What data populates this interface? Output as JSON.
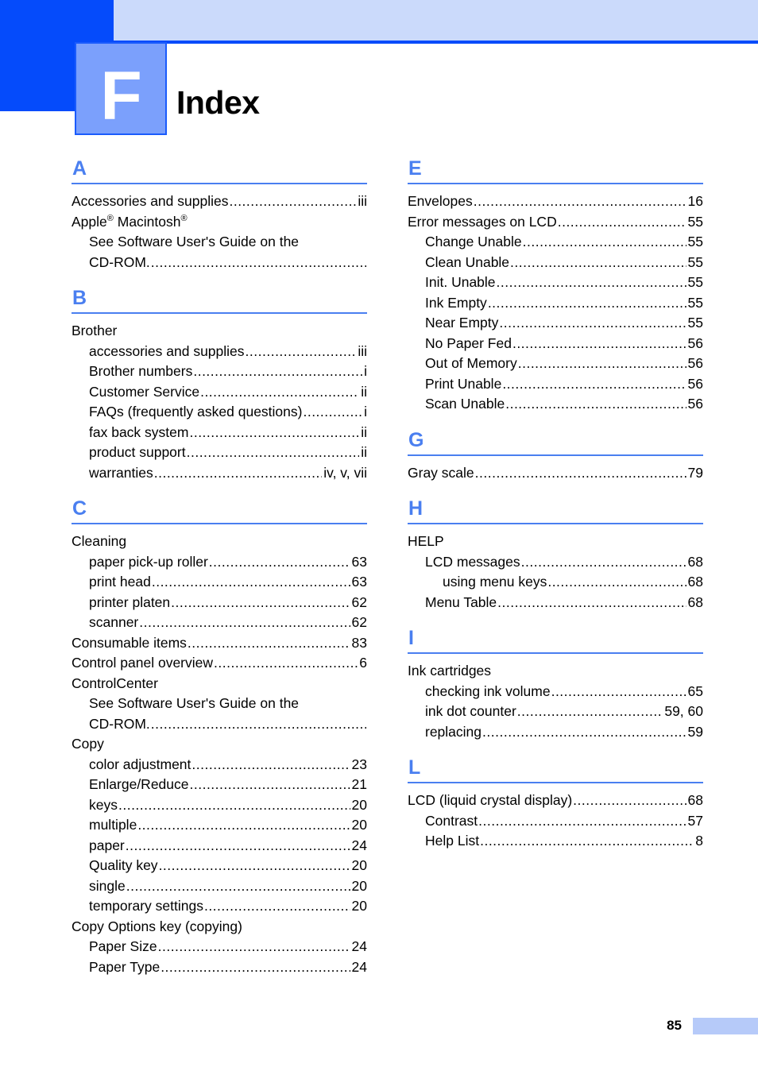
{
  "header": {
    "chapter_letter": "F",
    "title": "Index",
    "colors": {
      "dark_blue": "#054bfb",
      "banner_blue": "#cbdafb",
      "tile_blue": "#7ba0fc",
      "accent_blue": "#4a7ff0",
      "footer_bar": "#b6caf9"
    }
  },
  "footer": {
    "page_number": "85"
  },
  "columns": {
    "left": [
      {
        "letter": "A",
        "entries": [
          {
            "level": 1,
            "label": "Accessories and supplies",
            "page": "iii",
            "leader": true
          },
          {
            "level": 1,
            "label": "Apple® Macintosh®",
            "page": "",
            "leader": false,
            "html": "Apple<sup>®</sup> Macintosh<sup>®</sup>"
          },
          {
            "level": 2,
            "label": "See Software User's Guide on the",
            "page": "",
            "leader": false
          },
          {
            "level": 2,
            "label": "CD-ROM.",
            "page": "",
            "leader": true
          }
        ]
      },
      {
        "letter": "B",
        "entries": [
          {
            "level": 1,
            "label": "Brother",
            "page": "",
            "leader": false
          },
          {
            "level": 2,
            "label": "accessories and supplies",
            "page": "iii",
            "leader": true
          },
          {
            "level": 2,
            "label": "Brother numbers",
            "page": "i",
            "leader": true
          },
          {
            "level": 2,
            "label": "Customer Service",
            "page": "ii",
            "leader": true
          },
          {
            "level": 2,
            "label": "FAQs (frequently asked questions)",
            "page": "i",
            "leader": true
          },
          {
            "level": 2,
            "label": "fax back system",
            "page": "ii",
            "leader": true
          },
          {
            "level": 2,
            "label": "product support",
            "page": "ii",
            "leader": true
          },
          {
            "level": 2,
            "label": "warranties",
            "page": "iv, v, vii",
            "leader": true
          }
        ]
      },
      {
        "letter": "C",
        "entries": [
          {
            "level": 1,
            "label": "Cleaning",
            "page": "",
            "leader": false
          },
          {
            "level": 2,
            "label": "paper pick-up roller",
            "page": "63",
            "leader": true
          },
          {
            "level": 2,
            "label": "print head",
            "page": "63",
            "leader": true
          },
          {
            "level": 2,
            "label": "printer platen",
            "page": "62",
            "leader": true
          },
          {
            "level": 2,
            "label": "scanner",
            "page": "62",
            "leader": true
          },
          {
            "level": 1,
            "label": "Consumable items",
            "page": "83",
            "leader": true
          },
          {
            "level": 1,
            "label": "Control panel overview",
            "page": "6",
            "leader": true
          },
          {
            "level": 1,
            "label": "ControlCenter",
            "page": "",
            "leader": false
          },
          {
            "level": 2,
            "label": "See Software User's Guide on the",
            "page": "",
            "leader": false
          },
          {
            "level": 2,
            "label": "CD-ROM.",
            "page": "",
            "leader": true
          },
          {
            "level": 1,
            "label": "Copy",
            "page": "",
            "leader": false
          },
          {
            "level": 2,
            "label": "color adjustment",
            "page": "23",
            "leader": true
          },
          {
            "level": 2,
            "label": "Enlarge/Reduce",
            "page": "21",
            "leader": true
          },
          {
            "level": 2,
            "label": "keys",
            "page": "20",
            "leader": true
          },
          {
            "level": 2,
            "label": "multiple",
            "page": "20",
            "leader": true
          },
          {
            "level": 2,
            "label": "paper",
            "page": "24",
            "leader": true
          },
          {
            "level": 2,
            "label": "Quality key",
            "page": "20",
            "leader": true
          },
          {
            "level": 2,
            "label": "single",
            "page": "20",
            "leader": true
          },
          {
            "level": 2,
            "label": "temporary settings",
            "page": "20",
            "leader": true
          },
          {
            "level": 1,
            "label": "Copy Options key (copying)",
            "page": "",
            "leader": false
          },
          {
            "level": 2,
            "label": "Paper Size",
            "page": "24",
            "leader": true
          },
          {
            "level": 2,
            "label": "Paper Type",
            "page": "24",
            "leader": true
          }
        ]
      }
    ],
    "right": [
      {
        "letter": "E",
        "entries": [
          {
            "level": 1,
            "label": "Envelopes",
            "page": "16",
            "leader": true
          },
          {
            "level": 1,
            "label": "Error messages on LCD",
            "page": "55",
            "leader": true
          },
          {
            "level": 2,
            "label": "Change Unable",
            "page": "55",
            "leader": true
          },
          {
            "level": 2,
            "label": "Clean Unable",
            "page": "55",
            "leader": true
          },
          {
            "level": 2,
            "label": "Init. Unable",
            "page": "55",
            "leader": true
          },
          {
            "level": 2,
            "label": "Ink Empty",
            "page": "55",
            "leader": true
          },
          {
            "level": 2,
            "label": "Near Empty",
            "page": "55",
            "leader": true
          },
          {
            "level": 2,
            "label": "No Paper Fed",
            "page": "56",
            "leader": true
          },
          {
            "level": 2,
            "label": "Out of Memory",
            "page": "56",
            "leader": true
          },
          {
            "level": 2,
            "label": "Print Unable",
            "page": "56",
            "leader": true
          },
          {
            "level": 2,
            "label": "Scan Unable",
            "page": "56",
            "leader": true
          }
        ]
      },
      {
        "letter": "G",
        "entries": [
          {
            "level": 1,
            "label": "Gray scale",
            "page": "79",
            "leader": true
          }
        ]
      },
      {
        "letter": "H",
        "entries": [
          {
            "level": 1,
            "label": "HELP",
            "page": "",
            "leader": false
          },
          {
            "level": 2,
            "label": "LCD messages",
            "page": "68",
            "leader": true
          },
          {
            "level": 3,
            "label": "using menu keys",
            "page": "68",
            "leader": true
          },
          {
            "level": 2,
            "label": "Menu Table",
            "page": "68",
            "leader": true
          }
        ]
      },
      {
        "letter": "I",
        "entries": [
          {
            "level": 1,
            "label": "Ink cartridges",
            "page": "",
            "leader": false
          },
          {
            "level": 2,
            "label": "checking ink volume",
            "page": "65",
            "leader": true
          },
          {
            "level": 2,
            "label": "ink dot counter",
            "page": "59, 60",
            "leader": true
          },
          {
            "level": 2,
            "label": "replacing",
            "page": "59",
            "leader": true
          }
        ]
      },
      {
        "letter": "L",
        "entries": [
          {
            "level": 1,
            "label": "LCD (liquid crystal display)",
            "page": "68",
            "leader": true
          },
          {
            "level": 2,
            "label": "Contrast",
            "page": "57",
            "leader": true
          },
          {
            "level": 2,
            "label": "Help List",
            "page": "8",
            "leader": true
          }
        ]
      }
    ]
  }
}
